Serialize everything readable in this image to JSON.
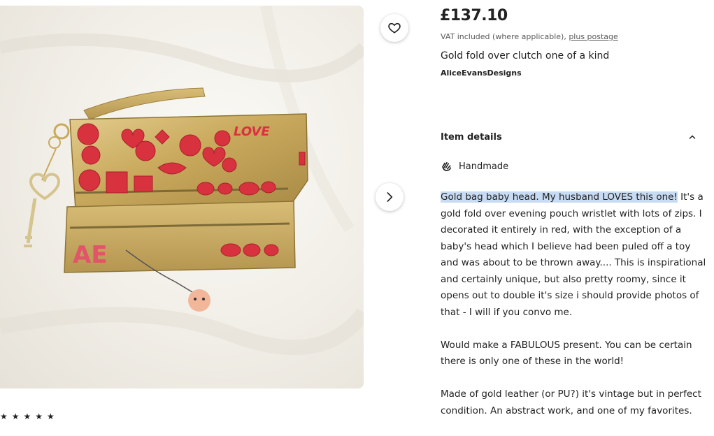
{
  "listing": {
    "price": "£137.10",
    "vat_text": "VAT included (where applicable), ",
    "postage_link": "plus postage",
    "title": "Gold fold over clutch one of a kind",
    "shop_name": "AliceEvansDesigns"
  },
  "photo": {
    "alt": "Gold fold over clutch decorated with red embellishments",
    "bag_text": "LOVE",
    "bag_initials": "AE"
  },
  "buttons": {
    "favorite_icon": "heart-icon",
    "next_icon": "chevron-right-icon"
  },
  "item_details": {
    "heading": "Item details",
    "toggle_icon": "chevron-up-icon",
    "handmade_icon": "hand-icon",
    "handmade_label": "Handmade",
    "highlighted": "Gold bag baby head. My husband LOVES this one!",
    "paragraph1_rest": " It's a gold fold over evening pouch wristlet with lots of zips. I decorated it entirely in red, with the exception of a baby's head which I believe had been puled off a toy and was about to be thrown away.... This is inspirational and certainly unique, but also pretty roomy, since it opens out to double it's size i should provide photos of that - I will if you convo me.",
    "paragraph2": "Would make a FABULOUS present. You can be certain there is only one of these in the world!",
    "paragraph3": "Made of gold leather (or PU?) it's vintage but in perfect condition. An abstract work, and one of my favorites."
  },
  "reviews": {
    "stars": "★★★★★"
  },
  "colors": {
    "highlight": "#c7dbf3",
    "gold": "#c9a95c",
    "red_decoration": "#d8323f"
  }
}
